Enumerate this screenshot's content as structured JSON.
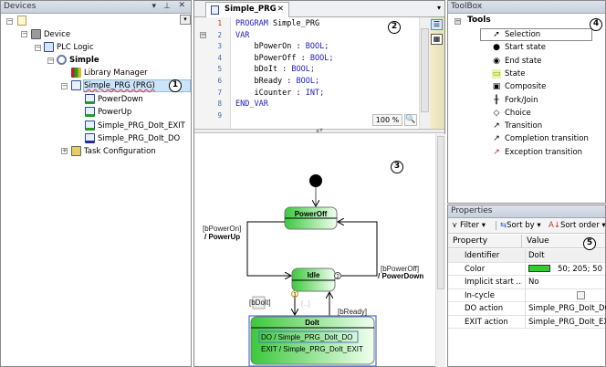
{
  "devices": {
    "title": "Devices",
    "items": [
      {
        "label": "Device"
      },
      {
        "label": "PLC Logic"
      },
      {
        "label": "Simple"
      },
      {
        "label": "Library Manager"
      },
      {
        "label": "Simple_PRG (PRG)"
      },
      {
        "label": "PowerDown"
      },
      {
        "label": "PowerUp"
      },
      {
        "label": "Simple_PRG_DoIt_EXIT"
      },
      {
        "label": "Simple_PRG_DoIt_DO"
      },
      {
        "label": "Task Configuration"
      }
    ]
  },
  "editor": {
    "tab_label": "Simple_PRG",
    "zoom": "100 %",
    "lines": [
      {
        "n": "1",
        "a": "PROGRAM",
        "b": " Simple_PRG",
        "c": ""
      },
      {
        "n": "2",
        "a": "VAR",
        "b": "",
        "c": ""
      },
      {
        "n": "3",
        "a": "",
        "b": "    bPowerOn : ",
        "c": "BOOL;"
      },
      {
        "n": "4",
        "a": "",
        "b": "    bPowerOff : ",
        "c": "BOOL;"
      },
      {
        "n": "5",
        "a": "",
        "b": "    bDoIt : ",
        "c": "BOOL;"
      },
      {
        "n": "6",
        "a": "",
        "b": "    bReady : ",
        "c": "BOOL;"
      },
      {
        "n": "7",
        "a": "",
        "b": "    iCounter : ",
        "c": "INT;"
      },
      {
        "n": "8",
        "a": "END_VAR",
        "b": "",
        "c": ""
      },
      {
        "n": "9",
        "a": "",
        "b": "",
        "c": ""
      }
    ]
  },
  "diagram": {
    "states": {
      "poweroff": "PowerOff",
      "idle": "Idle",
      "doit": "DoIt"
    },
    "doit_do": "DO / Simple_PRG_DoIt_DO",
    "doit_exit": "EXIT / Simple_PRG_DoIt_EXIT",
    "t_poweron_guard": "[bPowerOn]",
    "t_poweron_action": "/ PowerUp",
    "t_poweroff_guard": "[bPowerOff]",
    "t_poweroff_action": "/ PowerDown",
    "t_doit_guard": "[bDoIt]",
    "t_ready_guard": "[bReady]",
    "placeholder": "[...]",
    "prio1": "1",
    "prio2": "2"
  },
  "toolbox": {
    "title": "ToolBox",
    "group": "Tools",
    "items": [
      {
        "label": "Selection",
        "icon": "cursor-icon"
      },
      {
        "label": "Start state",
        "icon": "start-state-icon"
      },
      {
        "label": "End state",
        "icon": "end-state-icon"
      },
      {
        "label": "State",
        "icon": "state-icon"
      },
      {
        "label": "Composite",
        "icon": "composite-icon"
      },
      {
        "label": "Fork/Join",
        "icon": "fork-join-icon"
      },
      {
        "label": "Choice",
        "icon": "choice-icon"
      },
      {
        "label": "Transition",
        "icon": "transition-icon"
      },
      {
        "label": "Completion transition",
        "icon": "completion-transition-icon"
      },
      {
        "label": "Exception transition",
        "icon": "exception-transition-icon"
      }
    ]
  },
  "properties": {
    "title": "Properties",
    "filter": "Filter",
    "sort_by": "Sort by",
    "sort_order": "Sort order",
    "col_property": "Property",
    "col_value": "Value",
    "rows": [
      {
        "name": "Identifier",
        "value": "DoIt"
      },
      {
        "name": "Color",
        "value": "50; 205; 50"
      },
      {
        "name": "Implicit start ...",
        "value": "No"
      },
      {
        "name": "In-cycle",
        "value": ""
      },
      {
        "name": "DO action",
        "value": "Simple_PRG_DoIt_DO"
      },
      {
        "name": "EXIT action",
        "value": "Simple_PRG_DoIt_EXIT"
      }
    ],
    "color_swatch": "#32cd32",
    "in_cycle_checked": false
  },
  "callouts": [
    "1",
    "2",
    "3",
    "4",
    "5"
  ],
  "colors": {
    "state_green": "#3cc83c",
    "selection": "#cce4f7",
    "keyword": "#2020c0"
  }
}
